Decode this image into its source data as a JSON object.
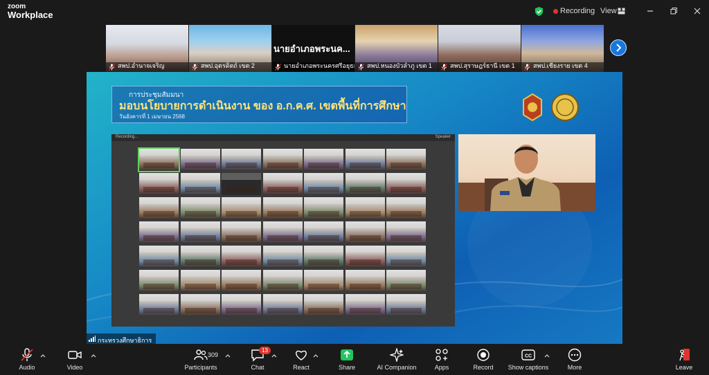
{
  "app": {
    "brand_top": "zoom",
    "brand_bottom": "Workplace"
  },
  "titlebar": {
    "recording_label": "Recording",
    "view_label": "View",
    "accent": "#e0342c"
  },
  "participants_strip": [
    {
      "name": "สพป.อำนาจเจริญ",
      "mic": "muted"
    },
    {
      "name": "สพป.อุตรดิตถ์ เขต 2",
      "mic": "muted"
    },
    {
      "name": "นายอำเภอพระนครศรีอยุธยา",
      "display": "นายอำเภอพระนค...",
      "mic": "muted"
    },
    {
      "name": "สพป.หนองบัวลำภู เขต 1",
      "mic": "muted"
    },
    {
      "name": "สพป.สุราษฎร์ธานี เขต 1",
      "mic": "muted"
    },
    {
      "name": "สพป.เชียงราย เขต 4",
      "mic": "muted"
    }
  ],
  "shared_screen": {
    "banner_line1": "การประชุมสัมมนา",
    "banner_title": "มอบนโยบายการดำเนินงาน ของ อ.ก.ค.ศ. เขตพื้นที่การศึกษา",
    "banner_date": "วันอังคารที่ 1 เมษายน 2568",
    "inner_gallery_left": "Recording...",
    "inner_gallery_right": "Speaker",
    "presenter_label": "กระทรวงศึกษาธิการ"
  },
  "toolbar": {
    "audio": "Audio",
    "video": "Video",
    "participants": "Participants",
    "participants_count": "309",
    "chat": "Chat",
    "chat_badge": "13",
    "react": "React",
    "share": "Share",
    "ai_companion": "AI Companion",
    "apps": "Apps",
    "record": "Record",
    "captions": "Show captions",
    "more": "More",
    "leave": "Leave"
  },
  "colors": {
    "share_green": "#22c55e",
    "leave_red": "#e0342c",
    "next_blue": "#1677e0",
    "shield_green": "#22c55e"
  }
}
